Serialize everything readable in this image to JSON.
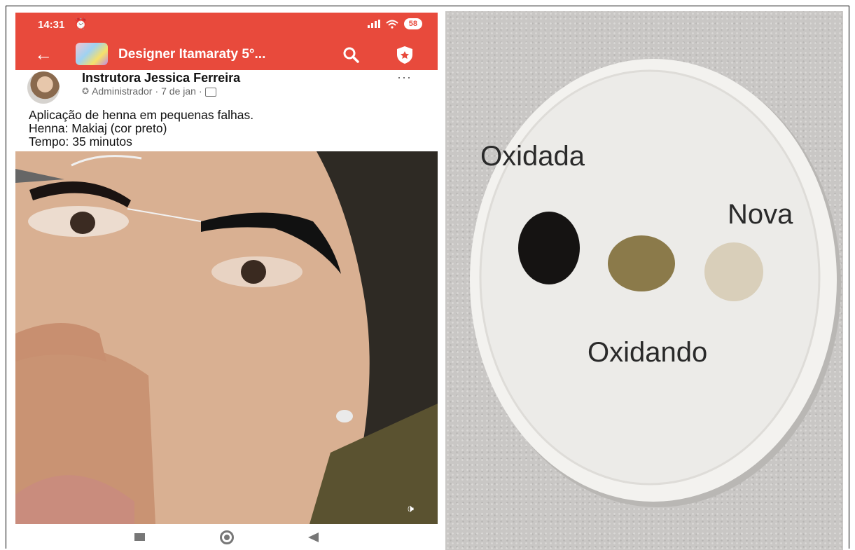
{
  "status_bar": {
    "time": "14:31",
    "battery": "58",
    "alarm_icon": "alarm-clock-icon",
    "signal_icon": "signal-icon",
    "wifi_icon": "wifi-icon"
  },
  "app_bar": {
    "group_title": "Designer Itamaraty 5°...",
    "color": "#e84a3c"
  },
  "post": {
    "author": "Instrutora Jessica Ferreira",
    "role": "Administrador",
    "date": "7 de jan",
    "separator": "·",
    "lines": [
      "Aplicação de henna em pequenas falhas.",
      "Henna: Makiaj (cor preto)",
      "Tempo: 35 minutos"
    ],
    "more": "···"
  },
  "video": {
    "volume_icon": "volume-icon",
    "volume_glyph": "🕩"
  },
  "photo_labels": {
    "oxidada": "Oxidada",
    "nova": "Nova",
    "oxidando": "Oxidando"
  }
}
